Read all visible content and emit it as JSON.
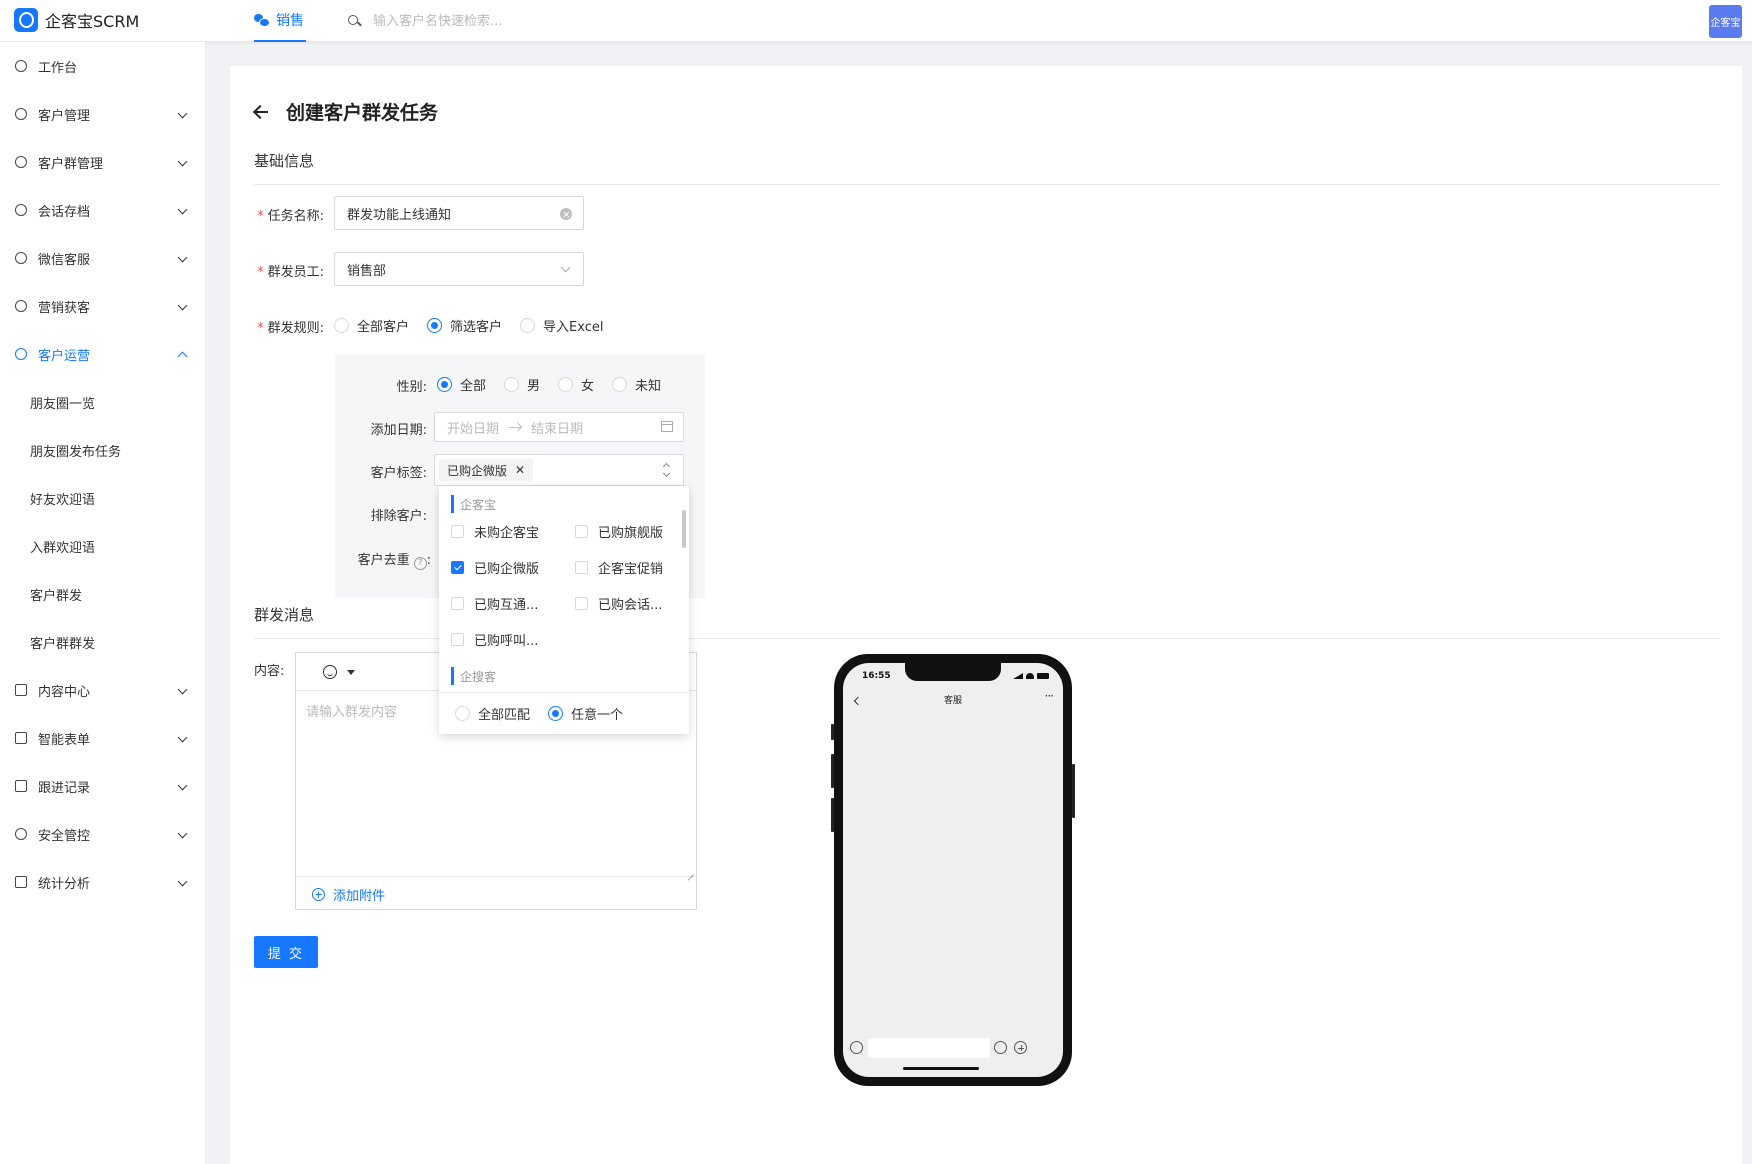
{
  "app": {
    "title": "企客宝SCRM",
    "avatar_text": "企客宝"
  },
  "header": {
    "active_tab": "销售",
    "search_placeholder": "输入客户名快速检索..."
  },
  "sidebar": {
    "items": [
      {
        "label": "工作台",
        "icon": "dashboard-icon"
      },
      {
        "label": "客户管理",
        "icon": "user-icon"
      },
      {
        "label": "客户群管理",
        "icon": "group-icon"
      },
      {
        "label": "会话存档",
        "icon": "chat-icon"
      },
      {
        "label": "微信客服",
        "icon": "wechat-service-icon"
      },
      {
        "label": "营销获客",
        "icon": "bulb-icon"
      },
      {
        "label": "客户运营",
        "icon": "operation-icon",
        "expanded": true
      },
      {
        "label": "内容中心",
        "icon": "content-icon"
      },
      {
        "label": "智能表单",
        "icon": "form-icon"
      },
      {
        "label": "跟进记录",
        "icon": "record-icon"
      },
      {
        "label": "安全管控",
        "icon": "shield-icon"
      },
      {
        "label": "统计分析",
        "icon": "chart-icon"
      }
    ],
    "subitems": [
      "朋友圈一览",
      "朋友圈发布任务",
      "好友欢迎语",
      "入群欢迎语",
      "客户群发",
      "客户群群发"
    ]
  },
  "page": {
    "title": "创建客户群发任务",
    "basic_section": "基础信息",
    "message_section": "群发消息"
  },
  "form": {
    "task_name_label": "任务名称:",
    "task_name_value": "群发功能上线通知",
    "staff_label": "群发员工:",
    "staff_value": "销售部",
    "rule_label": "群发规则:",
    "rule_options": [
      "全部客户",
      "筛选客户",
      "导入Excel"
    ],
    "rule_selected": "筛选客户"
  },
  "filter": {
    "gender_label": "性别:",
    "gender_options": [
      "全部",
      "男",
      "女",
      "未知"
    ],
    "gender_selected": "全部",
    "date_label": "添加日期:",
    "date_start_placeholder": "开始日期",
    "date_end_placeholder": "结束日期",
    "tag_label": "客户标签:",
    "tag_selected": "已购企微版",
    "exclude_label": "排除客户:",
    "dedupe_label": "客户去重"
  },
  "tag_dropdown": {
    "group1": "企客宝",
    "options": [
      {
        "label": "未购企客宝",
        "checked": false
      },
      {
        "label": "已购旗舰版",
        "checked": false
      },
      {
        "label": "已购企微版",
        "checked": true
      },
      {
        "label": "企客宝促销",
        "checked": false
      },
      {
        "label": "已购互通...",
        "checked": false
      },
      {
        "label": "已购会话...",
        "checked": false
      },
      {
        "label": "已购呼叫...",
        "checked": false
      }
    ],
    "group2": "企搜客",
    "match_options": [
      "全部匹配",
      "任意一个"
    ],
    "match_selected": "任意一个"
  },
  "message": {
    "content_label": "内容:",
    "placeholder": "请输入群发内容",
    "attach_label": "添加附件"
  },
  "submit_label": "提 交",
  "phone": {
    "time": "16:55",
    "title": "客服",
    "more": "···"
  },
  "colors": {
    "accent": "#1677ff",
    "required": "#ff4d4f",
    "avatar_bg": "#5b7cf0"
  }
}
